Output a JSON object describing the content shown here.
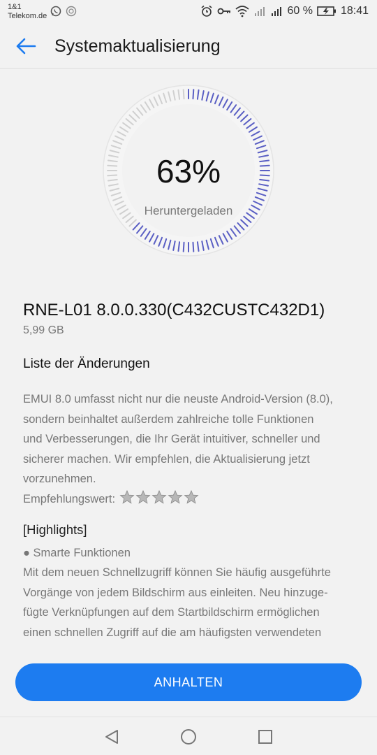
{
  "status_bar": {
    "carrier_line1": "1&1",
    "carrier_line2": "Telekom.de",
    "battery_percent": "60 %",
    "time": "18:41",
    "icons": [
      "whatsapp-icon",
      "notification-icon",
      "alarm-icon",
      "key-icon",
      "wifi-icon",
      "signal-icon",
      "signal-icon",
      "battery-charging-icon"
    ]
  },
  "header": {
    "title": "Systemaktualisierung",
    "back_icon": "arrow-left-icon"
  },
  "download": {
    "percent_text": "63%",
    "progress": 0.63,
    "status_label": "Heruntergeladen",
    "colors": {
      "done": "#5a5fc4",
      "remaining": "#d0d0d0"
    }
  },
  "update": {
    "version": "RNE-L01 8.0.0.330(C432CUSTC432D1)",
    "size": "5,99 GB"
  },
  "changes": {
    "title": "Liste der Änderungen",
    "lines": [
      "EMUI 8.0 umfasst nicht nur die neuste Android-Version (8.0),",
      "sondern beinhaltet außerdem zahlreiche tolle Funktionen",
      "und Verbesserungen, die Ihr Gerät intuitiver, schneller und",
      "sicherer machen. Wir empfehlen, die Aktualisierung jetzt",
      "vorzunehmen."
    ],
    "rating_label": "Empfehlungswert:",
    "rating": 5,
    "highlights_title": "[Highlights]",
    "highlight_lines": [
      "● Smarte Funktionen",
      "Mit dem neuen Schnellzugriff können Sie häufig ausgeführte",
      "Vorgänge von jedem Bildschirm aus einleiten. Neu hinzuge-",
      "fügte Verknüpfungen auf dem Startbildschirm ermöglichen",
      "einen schnellen Zugriff auf die am häufigsten verwendeten"
    ]
  },
  "actions": {
    "pause_label": "ANHALTEN",
    "accent": "#1d7cf0"
  },
  "nav_bar": {
    "buttons": [
      "back-triangle-icon",
      "home-circle-icon",
      "recents-square-icon"
    ]
  }
}
